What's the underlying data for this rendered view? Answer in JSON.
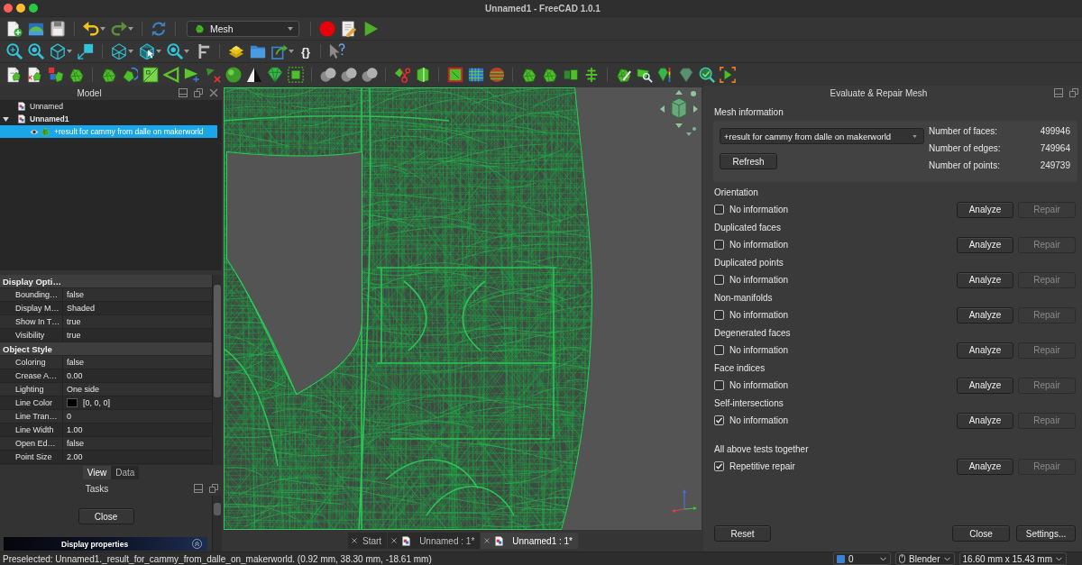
{
  "window": {
    "title": "Unnamed1 - FreeCAD 1.0.1"
  },
  "toolbar": {
    "workbench": "Mesh",
    "glyph_button": "{}"
  },
  "model_panel": {
    "title": "Model",
    "tree": [
      {
        "label": "Unnamed",
        "active": false,
        "selected": false
      },
      {
        "label": "Unnamed1",
        "active": true,
        "selected": false,
        "expanded": true,
        "children": [
          {
            "label": "+result for cammy from dalle on makerworld",
            "active": false,
            "selected": true
          }
        ]
      }
    ]
  },
  "property_view": {
    "groups": [
      {
        "name": "Display Opti…",
        "rows": [
          {
            "name": "Bounding…",
            "value": "false"
          },
          {
            "name": "Display M…",
            "value": "Shaded"
          },
          {
            "name": "Show In T…",
            "value": "true"
          },
          {
            "name": "Visibility",
            "value": "true"
          }
        ]
      },
      {
        "name": "Object Style",
        "rows": [
          {
            "name": "Coloring",
            "value": "false"
          },
          {
            "name": "Crease A…",
            "value": "0.00"
          },
          {
            "name": "Lighting",
            "value": "One side"
          },
          {
            "name": "Line Color",
            "value": "[0, 0, 0]",
            "color": "#000000"
          },
          {
            "name": "Line Tran…",
            "value": "0"
          },
          {
            "name": "Line Width",
            "value": "1.00"
          },
          {
            "name": "Open Ed…",
            "value": "false"
          },
          {
            "name": "Point Size",
            "value": "2.00"
          }
        ]
      }
    ],
    "tabs": [
      {
        "label": "View",
        "selected": true
      },
      {
        "label": "Data",
        "selected": false
      }
    ]
  },
  "tasks_panel": {
    "title": "Tasks",
    "button": "Close",
    "section": "Display properties"
  },
  "document_tabs": [
    {
      "label": "Start",
      "kind": "start",
      "selected": false
    },
    {
      "label": "Unnamed : 1*",
      "kind": "document",
      "selected": false
    },
    {
      "label": "Unnamed1 : 1*",
      "kind": "document",
      "selected": true
    }
  ],
  "repair_panel": {
    "title": "Evaluate & Repair Mesh",
    "mesh_information": {
      "heading": "Mesh information",
      "mesh": "+result for cammy from dalle on makerworld",
      "refresh_button": "Refresh",
      "stats": [
        {
          "label": "Number of faces:",
          "value": "499946"
        },
        {
          "label": "Number of edges:",
          "value": "749964"
        },
        {
          "label": "Number of points:",
          "value": "249739"
        }
      ]
    },
    "checks": [
      {
        "heading": "Orientation",
        "label": "No information",
        "checked": false,
        "buttons": [
          {
            "label": "Analyze",
            "disabled": false
          },
          {
            "label": "Repair",
            "disabled": true
          }
        ]
      },
      {
        "heading": "Duplicated faces",
        "label": "No information",
        "checked": false,
        "buttons": [
          {
            "label": "Analyze",
            "disabled": false
          },
          {
            "label": "Repair",
            "disabled": true
          }
        ]
      },
      {
        "heading": "Duplicated points",
        "label": "No information",
        "checked": false,
        "buttons": [
          {
            "label": "Analyze",
            "disabled": false
          },
          {
            "label": "Repair",
            "disabled": true
          }
        ]
      },
      {
        "heading": "Non-manifolds",
        "label": "No information",
        "checked": false,
        "buttons": [
          {
            "label": "Analyze",
            "disabled": false
          },
          {
            "label": "Repair",
            "disabled": true
          }
        ]
      },
      {
        "heading": "Degenerated faces",
        "label": "No information",
        "checked": false,
        "buttons": [
          {
            "label": "Analyze",
            "disabled": false
          },
          {
            "label": "Repair",
            "disabled": true
          }
        ]
      },
      {
        "heading": "Face indices",
        "label": "No information",
        "checked": false,
        "buttons": [
          {
            "label": "Analyze",
            "disabled": false
          },
          {
            "label": "Repair",
            "disabled": true
          }
        ]
      },
      {
        "heading": "Self-intersections",
        "label": "No information",
        "checked": true,
        "buttons": [
          {
            "label": "Analyze",
            "disabled": false
          },
          {
            "label": "Repair",
            "disabled": true
          }
        ]
      }
    ],
    "combined_test": {
      "heading": "All above tests together",
      "label": "Repetitive repair",
      "checked": true,
      "buttons": [
        {
          "label": "Analyze",
          "disabled": false
        },
        {
          "label": "Repair",
          "disabled": true
        }
      ]
    },
    "reset_button": "Reset",
    "buttons": [
      "Close",
      "Settings..."
    ]
  },
  "status_bar": {
    "message": "Preselected: Unnamed1._result_for_cammy_from_dalle_on_makerworld. (0.92 mm, 38.30 mm, -18.61 mm)",
    "dropdowns": [
      {
        "kind": "swatch",
        "value": "0"
      },
      {
        "kind": "mouse",
        "value": "Blender"
      },
      {
        "kind": "plain",
        "value": "16.60 mm x 15.43 mm"
      }
    ]
  }
}
